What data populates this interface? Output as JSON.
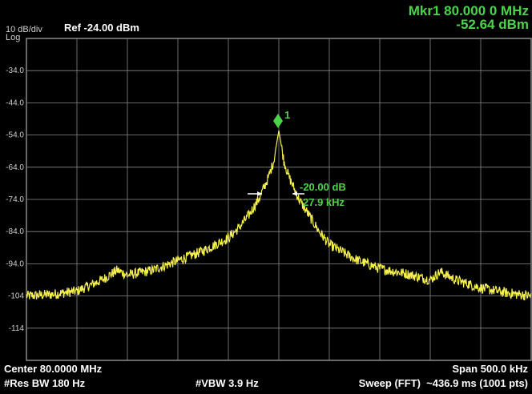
{
  "header": {
    "scale": "10 dB/div",
    "scale_type": "Log",
    "ref_level": "Ref -24.00 dBm",
    "marker_readout": "Mkr1 80.000 0 MHz",
    "marker_level": "-52.64 dBm"
  },
  "y_axis": {
    "tick_labels": [
      "-34.0",
      "-44.0",
      "-54.0",
      "-64.0",
      "-74.0",
      "-84.0",
      "-94.0",
      "-104",
      "-114"
    ]
  },
  "marker": {
    "number": "1",
    "delta_level": "-20.00 dB",
    "bandwidth": "27.9 kHz"
  },
  "footer": {
    "center": "Center 80.0000 MHz",
    "span": "Span 500.0 kHz",
    "rbw": "#Res BW 180 Hz",
    "vbw": "#VBW 3.9 Hz",
    "sweep": "Sweep (FFT)  ~436.9 ms (1001 pts)"
  },
  "colors": {
    "trace": "#f5f04a",
    "marker": "#4cd34c",
    "grid": "#8a8a8a",
    "text": "#ffffff"
  },
  "chart_data": {
    "type": "line",
    "x_unit": "MHz",
    "y_unit": "dBm",
    "xlim": [
      79.75,
      80.25
    ],
    "ylim": [
      -124,
      -24
    ],
    "series": [
      {
        "x": [
          79.75,
          79.775,
          79.8,
          79.825,
          79.84,
          79.85,
          79.875,
          79.9,
          79.925,
          79.95,
          79.96,
          79.97,
          79.98,
          79.99,
          79.995,
          80.0,
          80.005,
          80.01,
          80.02,
          80.03,
          80.04,
          80.05,
          80.075,
          80.1,
          80.125,
          80.15,
          80.16,
          80.175,
          80.2,
          80.225,
          80.25
        ],
        "y": [
          -104,
          -103.5,
          -102.5,
          -99,
          -96,
          -97.5,
          -96,
          -93,
          -90,
          -86,
          -83,
          -79,
          -74,
          -67,
          -62,
          -52.6,
          -62,
          -67,
          -74,
          -79,
          -84,
          -88,
          -92.5,
          -95.5,
          -97,
          -99,
          -96.5,
          -99,
          -101.5,
          -103,
          -104
        ]
      }
    ],
    "markers": [
      {
        "label": "1",
        "x": 80.0,
        "y": -52.64
      }
    ]
  }
}
